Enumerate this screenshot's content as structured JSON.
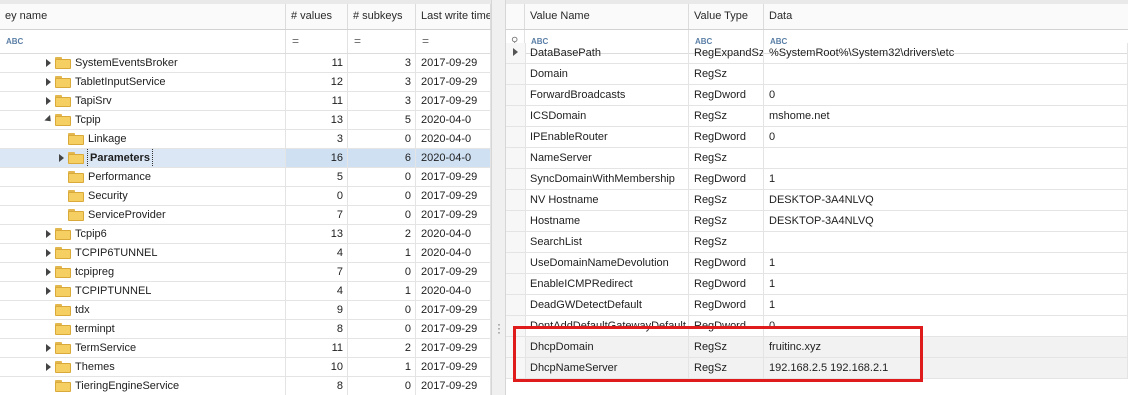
{
  "left": {
    "columns": [
      "ey name",
      "# values",
      "# subkeys",
      "Last write time"
    ],
    "filter": [
      "ABC",
      "=",
      "=",
      "="
    ],
    "rows": [
      {
        "name": "SystemEventsBroker",
        "values": "11",
        "subkeys": "3",
        "time": "2017-09-29",
        "expander": "closed",
        "level": 1
      },
      {
        "name": "TabletInputService",
        "values": "12",
        "subkeys": "3",
        "time": "2017-09-29",
        "expander": "closed",
        "level": 1
      },
      {
        "name": "TapiSrv",
        "values": "11",
        "subkeys": "3",
        "time": "2017-09-29",
        "expander": "closed",
        "level": 1
      },
      {
        "name": "Tcpip",
        "values": "13",
        "subkeys": "5",
        "time": "2020-04-0",
        "expander": "open",
        "level": 1
      },
      {
        "name": "Linkage",
        "values": "3",
        "subkeys": "0",
        "time": "2020-04-0",
        "expander": "none",
        "level": 2
      },
      {
        "name": "Parameters",
        "values": "16",
        "subkeys": "6",
        "time": "2020-04-0",
        "expander": "closed",
        "level": 2,
        "selected": true
      },
      {
        "name": "Performance",
        "values": "5",
        "subkeys": "0",
        "time": "2017-09-29",
        "expander": "none",
        "level": 2
      },
      {
        "name": "Security",
        "values": "0",
        "subkeys": "0",
        "time": "2017-09-29",
        "expander": "none",
        "level": 2
      },
      {
        "name": "ServiceProvider",
        "values": "7",
        "subkeys": "0",
        "time": "2017-09-29",
        "expander": "none",
        "level": 2
      },
      {
        "name": "Tcpip6",
        "values": "13",
        "subkeys": "2",
        "time": "2020-04-0",
        "expander": "closed",
        "level": 1
      },
      {
        "name": "TCPIP6TUNNEL",
        "values": "4",
        "subkeys": "1",
        "time": "2020-04-0",
        "expander": "closed",
        "level": 1
      },
      {
        "name": "tcpipreg",
        "values": "7",
        "subkeys": "0",
        "time": "2017-09-29",
        "expander": "closed",
        "level": 1
      },
      {
        "name": "TCPIPTUNNEL",
        "values": "4",
        "subkeys": "1",
        "time": "2020-04-0",
        "expander": "closed",
        "level": 1
      },
      {
        "name": "tdx",
        "values": "9",
        "subkeys": "0",
        "time": "2017-09-29",
        "expander": "none",
        "level": 1
      },
      {
        "name": "terminpt",
        "values": "8",
        "subkeys": "0",
        "time": "2017-09-29",
        "expander": "none",
        "level": 1
      },
      {
        "name": "TermService",
        "values": "11",
        "subkeys": "2",
        "time": "2017-09-29",
        "expander": "closed",
        "level": 1
      },
      {
        "name": "Themes",
        "values": "10",
        "subkeys": "1",
        "time": "2017-09-29",
        "expander": "closed",
        "level": 1
      },
      {
        "name": "TieringEngineService",
        "values": "8",
        "subkeys": "0",
        "time": "2017-09-29",
        "expander": "none",
        "level": 1
      }
    ]
  },
  "right": {
    "columns": [
      "Value Name",
      "Value Type",
      "Data"
    ],
    "filter": [
      "ABC",
      "ABC",
      "ABC"
    ],
    "rows": [
      {
        "name": "DataBasePath",
        "type": "RegExpandSz",
        "data": "%SystemRoot%\\System32\\drivers\\etc",
        "current": true
      },
      {
        "name": "Domain",
        "type": "RegSz",
        "data": ""
      },
      {
        "name": "ForwardBroadcasts",
        "type": "RegDword",
        "data": "0"
      },
      {
        "name": "ICSDomain",
        "type": "RegSz",
        "data": "mshome.net"
      },
      {
        "name": "IPEnableRouter",
        "type": "RegDword",
        "data": "0"
      },
      {
        "name": "NameServer",
        "type": "RegSz",
        "data": ""
      },
      {
        "name": "SyncDomainWithMembership",
        "type": "RegDword",
        "data": "1"
      },
      {
        "name": "NV Hostname",
        "type": "RegSz",
        "data": "DESKTOP-3A4NLVQ"
      },
      {
        "name": "Hostname",
        "type": "RegSz",
        "data": "DESKTOP-3A4NLVQ"
      },
      {
        "name": "SearchList",
        "type": "RegSz",
        "data": ""
      },
      {
        "name": "UseDomainNameDevolution",
        "type": "RegDword",
        "data": "1"
      },
      {
        "name": "EnableICMPRedirect",
        "type": "RegDword",
        "data": "1"
      },
      {
        "name": "DeadGWDetectDefault",
        "type": "RegDword",
        "data": "1"
      },
      {
        "name": "DontAddDefaultGatewayDefault",
        "type": "RegDword",
        "data": "0"
      },
      {
        "name": "DhcpDomain",
        "type": "RegSz",
        "data": "fruitinc.xyz",
        "highlighted": true
      },
      {
        "name": "DhcpNameServer",
        "type": "RegSz",
        "data": "192.168.2.5 192.168.2.1",
        "highlighted": true
      }
    ]
  },
  "colors": {
    "highlight_box": "#e01b1b",
    "folder": "#f6cf63",
    "selection": "#dbe7f5"
  }
}
